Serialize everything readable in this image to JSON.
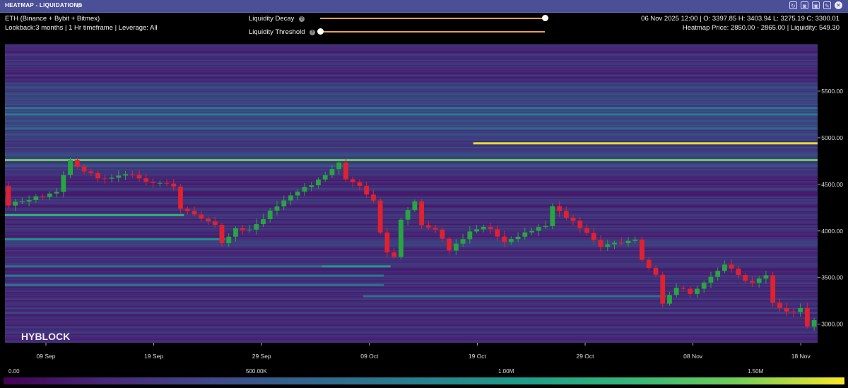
{
  "window": {
    "title": "HEATMAP - LIQUIDATIONS",
    "tune_icon": "sliders-icon",
    "buttons": [
      "refresh-icon",
      "camera-icon",
      "save-icon",
      "edit-icon",
      "close-icon"
    ]
  },
  "info": {
    "symbol": "ETH (Binance + Bybit + Bitmex)",
    "settings": "Lookback:3 months | 1 Hr timeframe | Leverage: All",
    "ohlc": "06 Nov 2025 12:00 | O: 3397.85 H: 3403.94 L: 3275.19 C: 3300.01",
    "heatmap_info": "Heatmap Price: 2850.00 - 2865.00 | Liquidity: 549.30"
  },
  "sliders": [
    {
      "label": "Liquidity Decay",
      "value": 1.0
    },
    {
      "label": "Liquidity Threshold",
      "value": 0.0
    }
  ],
  "colors": {
    "up": "#26a641",
    "down": "#e0212f",
    "highlight": "#fde725"
  },
  "chart_data": {
    "type": "heatmap",
    "watermark": "HYBLOCK",
    "x_ticks": [
      "09 Sep",
      "19 Sep",
      "29 Sep",
      "09 Oct",
      "19 Oct",
      "29 Oct",
      "08 Nov",
      "18 Nov"
    ],
    "y_ticks": [
      "5500.00",
      "5000.00",
      "4500.00",
      "4000.00",
      "3500.00",
      "3000.00"
    ],
    "ylim": [
      2800,
      6000
    ],
    "colorbar_ticks": [
      "0.00",
      "500.00K",
      "1.00M",
      "1.50M"
    ],
    "colorbar_range": [
      0,
      1750000
    ],
    "price_close_anchors": [
      [
        0,
        4500
      ],
      [
        1,
        4290
      ],
      [
        4,
        4330
      ],
      [
        8,
        4430
      ],
      [
        10,
        4780
      ],
      [
        12,
        4630
      ],
      [
        15,
        4560
      ],
      [
        18,
        4620
      ],
      [
        22,
        4510
      ],
      [
        25,
        4480
      ],
      [
        26,
        4220
      ],
      [
        28,
        4180
      ],
      [
        31,
        4080
      ],
      [
        32,
        3860
      ],
      [
        34,
        4010
      ],
      [
        36,
        4020
      ],
      [
        39,
        4200
      ],
      [
        43,
        4430
      ],
      [
        47,
        4580
      ],
      [
        49,
        4740
      ],
      [
        50,
        4560
      ],
      [
        52,
        4480
      ],
      [
        54,
        4330
      ],
      [
        55,
        3970
      ],
      [
        56,
        3760
      ],
      [
        57,
        3720
      ],
      [
        58,
        4120
      ],
      [
        60,
        4320
      ],
      [
        61,
        4080
      ],
      [
        63,
        4020
      ],
      [
        65,
        3780
      ],
      [
        68,
        3980
      ],
      [
        70,
        4060
      ],
      [
        73,
        3890
      ],
      [
        76,
        3990
      ],
      [
        79,
        4040
      ],
      [
        80,
        4260
      ],
      [
        83,
        4110
      ],
      [
        85,
        3980
      ],
      [
        87,
        3840
      ],
      [
        89,
        3870
      ],
      [
        92,
        3900
      ],
      [
        93,
        3690
      ],
      [
        95,
        3550
      ],
      [
        96,
        3220
      ],
      [
        98,
        3410
      ],
      [
        100,
        3340
      ],
      [
        103,
        3510
      ],
      [
        105,
        3620
      ],
      [
        107,
        3540
      ],
      [
        109,
        3430
      ],
      [
        111,
        3510
      ],
      [
        112,
        3220
      ],
      [
        114,
        3120
      ],
      [
        116,
        3180
      ],
      [
        117,
        2970
      ],
      [
        118,
        3060
      ]
    ],
    "liquidation_bands": [
      {
        "price": 4760,
        "from": 0,
        "to": 118,
        "intensity": 0.85
      },
      {
        "price": 4940,
        "from": 68,
        "to": 118,
        "intensity": 0.97
      },
      {
        "price": 5250,
        "from": 0,
        "to": 118,
        "intensity": 0.45
      },
      {
        "price": 5320,
        "from": 0,
        "to": 118,
        "intensity": 0.42
      },
      {
        "price": 5100,
        "from": 0,
        "to": 118,
        "intensity": 0.35
      },
      {
        "price": 4700,
        "from": 0,
        "to": 118,
        "intensity": 0.28
      },
      {
        "price": 4170,
        "from": 0,
        "to": 26,
        "intensity": 0.72
      },
      {
        "price": 3910,
        "from": 0,
        "to": 32,
        "intensity": 0.55
      },
      {
        "price": 3620,
        "from": 46,
        "to": 56,
        "intensity": 0.6
      },
      {
        "price": 3620,
        "from": 0,
        "to": 46,
        "intensity": 0.4
      },
      {
        "price": 3520,
        "from": 0,
        "to": 55,
        "intensity": 0.45
      },
      {
        "price": 3420,
        "from": 0,
        "to": 55,
        "intensity": 0.42
      },
      {
        "price": 3300,
        "from": 52,
        "to": 96,
        "intensity": 0.4
      }
    ]
  }
}
